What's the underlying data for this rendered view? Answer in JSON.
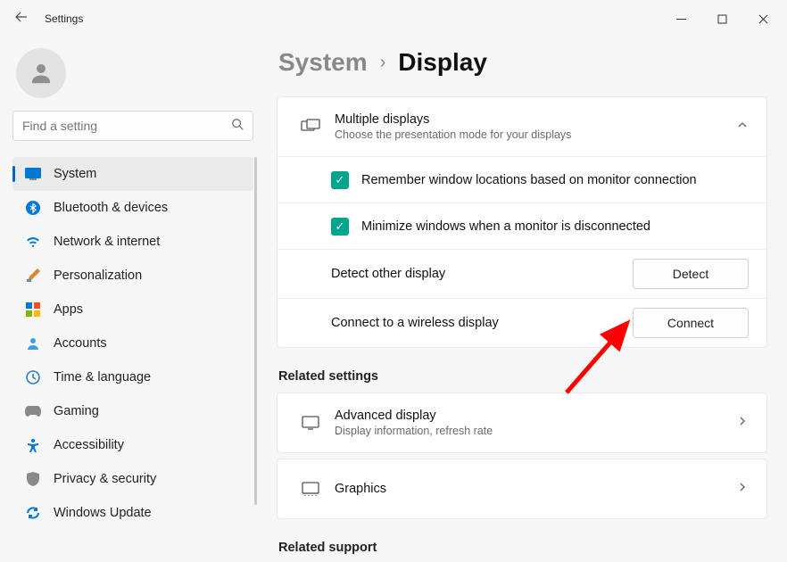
{
  "window": {
    "title": "Settings"
  },
  "search": {
    "placeholder": "Find a setting"
  },
  "nav": [
    {
      "label": "System"
    },
    {
      "label": "Bluetooth & devices"
    },
    {
      "label": "Network & internet"
    },
    {
      "label": "Personalization"
    },
    {
      "label": "Apps"
    },
    {
      "label": "Accounts"
    },
    {
      "label": "Time & language"
    },
    {
      "label": "Gaming"
    },
    {
      "label": "Accessibility"
    },
    {
      "label": "Privacy & security"
    },
    {
      "label": "Windows Update"
    }
  ],
  "breadcrumb": {
    "parent": "System",
    "current": "Display"
  },
  "multi": {
    "title": "Multiple displays",
    "subtitle": "Choose the presentation mode for your displays",
    "opt1": "Remember window locations based on monitor connection",
    "opt2": "Minimize windows when a monitor is disconnected",
    "detect_label": "Detect other display",
    "detect_btn": "Detect",
    "connect_label": "Connect to a wireless display",
    "connect_btn": "Connect"
  },
  "related": {
    "heading": "Related settings",
    "adv_title": "Advanced display",
    "adv_sub": "Display information, refresh rate",
    "graphics": "Graphics"
  },
  "support_heading": "Related support"
}
